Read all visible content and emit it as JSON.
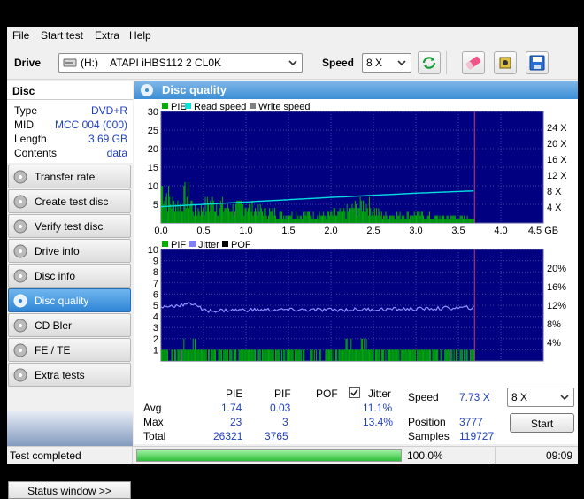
{
  "menu": [
    "File",
    "Start test",
    "Extra",
    "Help"
  ],
  "toolbar": {
    "drive_label": "Drive",
    "drive_letter": "(H:)",
    "drive_name": "ATAPI iHBS112   2 CL0K",
    "speed_label": "Speed",
    "speed_value": "8 X"
  },
  "disc": {
    "header": "Disc",
    "rows": [
      {
        "key": "Type",
        "value": "DVD+R"
      },
      {
        "key": "MID",
        "value": "MCC 004 (000)"
      },
      {
        "key": "Length",
        "value": "3.69 GB"
      },
      {
        "key": "Contents",
        "value": "data"
      }
    ]
  },
  "nav": [
    {
      "label": "Transfer rate",
      "icon": "transfer-rate-icon",
      "active": false
    },
    {
      "label": "Create test disc",
      "icon": "create-disc-icon",
      "active": false
    },
    {
      "label": "Verify test disc",
      "icon": "verify-disc-icon",
      "active": false
    },
    {
      "label": "Drive info",
      "icon": "drive-info-icon",
      "active": false
    },
    {
      "label": "Disc info",
      "icon": "disc-info-icon",
      "active": false
    },
    {
      "label": "Disc quality",
      "icon": "disc-quality-icon",
      "active": true
    },
    {
      "label": "CD Bler",
      "icon": "cd-bler-icon",
      "active": false
    },
    {
      "label": "FE / TE",
      "icon": "fe-te-icon",
      "active": false
    },
    {
      "label": "Extra tests",
      "icon": "extra-tests-icon",
      "active": false
    }
  ],
  "status_window_button": "Status window >>",
  "panel_title": "Disc quality",
  "colors": {
    "pie": "#00b000",
    "pif": "#00b000",
    "read_speed": "#00e0e0",
    "write_speed": "#808080",
    "jitter": "#8080ff",
    "pof": "#000000",
    "chart_bg": "#000080",
    "accent": "#3b8ed6"
  },
  "chart_data": [
    {
      "type": "bar",
      "legend": [
        "PIE",
        "Read speed",
        "Write speed"
      ],
      "xlim": [
        0,
        4.5
      ],
      "x_ticks": [
        "0.0",
        "0.5",
        "1.0",
        "1.5",
        "2.0",
        "2.5",
        "3.0",
        "3.5",
        "4.0",
        "4.5 GB"
      ],
      "ylim_left": [
        0,
        30
      ],
      "y_ticks_left": [
        "30",
        "25",
        "20",
        "15",
        "10",
        "5"
      ],
      "y_ticks_right": [
        "24 X",
        "20 X",
        "16 X",
        "12 X",
        "8 X",
        "4 X"
      ],
      "data_end": 3.69,
      "series": [
        {
          "name": "PIE",
          "x": [
            0.0,
            0.1,
            0.2,
            0.3,
            0.4,
            0.5,
            0.6,
            0.8,
            1.0,
            1.2,
            1.5,
            2.0,
            2.2,
            2.4,
            2.6,
            3.0,
            3.2,
            3.4,
            3.6,
            3.69
          ],
          "y": [
            13,
            8,
            6,
            10,
            4,
            6,
            7,
            5,
            6,
            4,
            3,
            3,
            4,
            7,
            3,
            3,
            2,
            2,
            2,
            1
          ]
        },
        {
          "name": "Read speed",
          "x": [
            0.0,
            1.0,
            2.0,
            3.0,
            3.69
          ],
          "y": [
            4.2,
            5.4,
            6.6,
            7.7,
            8.3
          ]
        }
      ]
    },
    {
      "type": "bar",
      "legend": [
        "PIF",
        "Jitter",
        "POF"
      ],
      "xlim": [
        0,
        4.5
      ],
      "x_ticks": [
        "0.0",
        "0.5",
        "1.0",
        "1.5",
        "2.0",
        "2.5",
        "3.0",
        "3.5",
        "4.0",
        "4.5 GB"
      ],
      "ylim_left": [
        0,
        10
      ],
      "y_ticks_left": [
        "10",
        "9",
        "8",
        "7",
        "6",
        "5",
        "4",
        "3",
        "2",
        "1"
      ],
      "y_ticks_right": [
        "20%",
        "16%",
        "12%",
        "8%",
        "4%"
      ],
      "data_end": 3.69,
      "series": [
        {
          "name": "PIF",
          "x": [
            0.0,
            0.1,
            0.2,
            0.3,
            0.5,
            0.8,
            1.0,
            1.5,
            2.0,
            2.4,
            2.5,
            3.0,
            3.5,
            3.69
          ],
          "y": [
            2,
            1,
            1,
            2,
            1,
            1,
            1,
            1,
            1,
            2,
            1,
            1,
            1,
            1
          ]
        },
        {
          "name": "Jitter",
          "x": [
            0.0,
            0.2,
            0.4,
            0.5,
            1.0,
            2.0,
            3.0,
            3.69
          ],
          "y": [
            11.6,
            12.0,
            12.4,
            10.8,
            11.0,
            11.0,
            11.2,
            11.5
          ]
        }
      ]
    }
  ],
  "stats": {
    "headers": [
      "PIE",
      "PIF",
      "POF",
      "Jitter"
    ],
    "rows": [
      {
        "label": "Avg",
        "pie": "1.74",
        "pif": "0.03",
        "jitter": "11.1%"
      },
      {
        "label": "Max",
        "pie": "23",
        "pif": "3",
        "jitter": "13.4%"
      },
      {
        "label": "Total",
        "pie": "26321",
        "pif": "3765"
      }
    ],
    "jitter_checked": true,
    "speed_label": "Speed",
    "speed_value": "7.73 X",
    "speed_select": "8 X",
    "position_label": "Position",
    "position_value": "3777",
    "samples_label": "Samples",
    "samples_value": "119727",
    "start_button": "Start"
  },
  "statusbar": {
    "status": "Test completed",
    "progress": 100,
    "progress_label": "100.0%",
    "time": "09:09"
  }
}
